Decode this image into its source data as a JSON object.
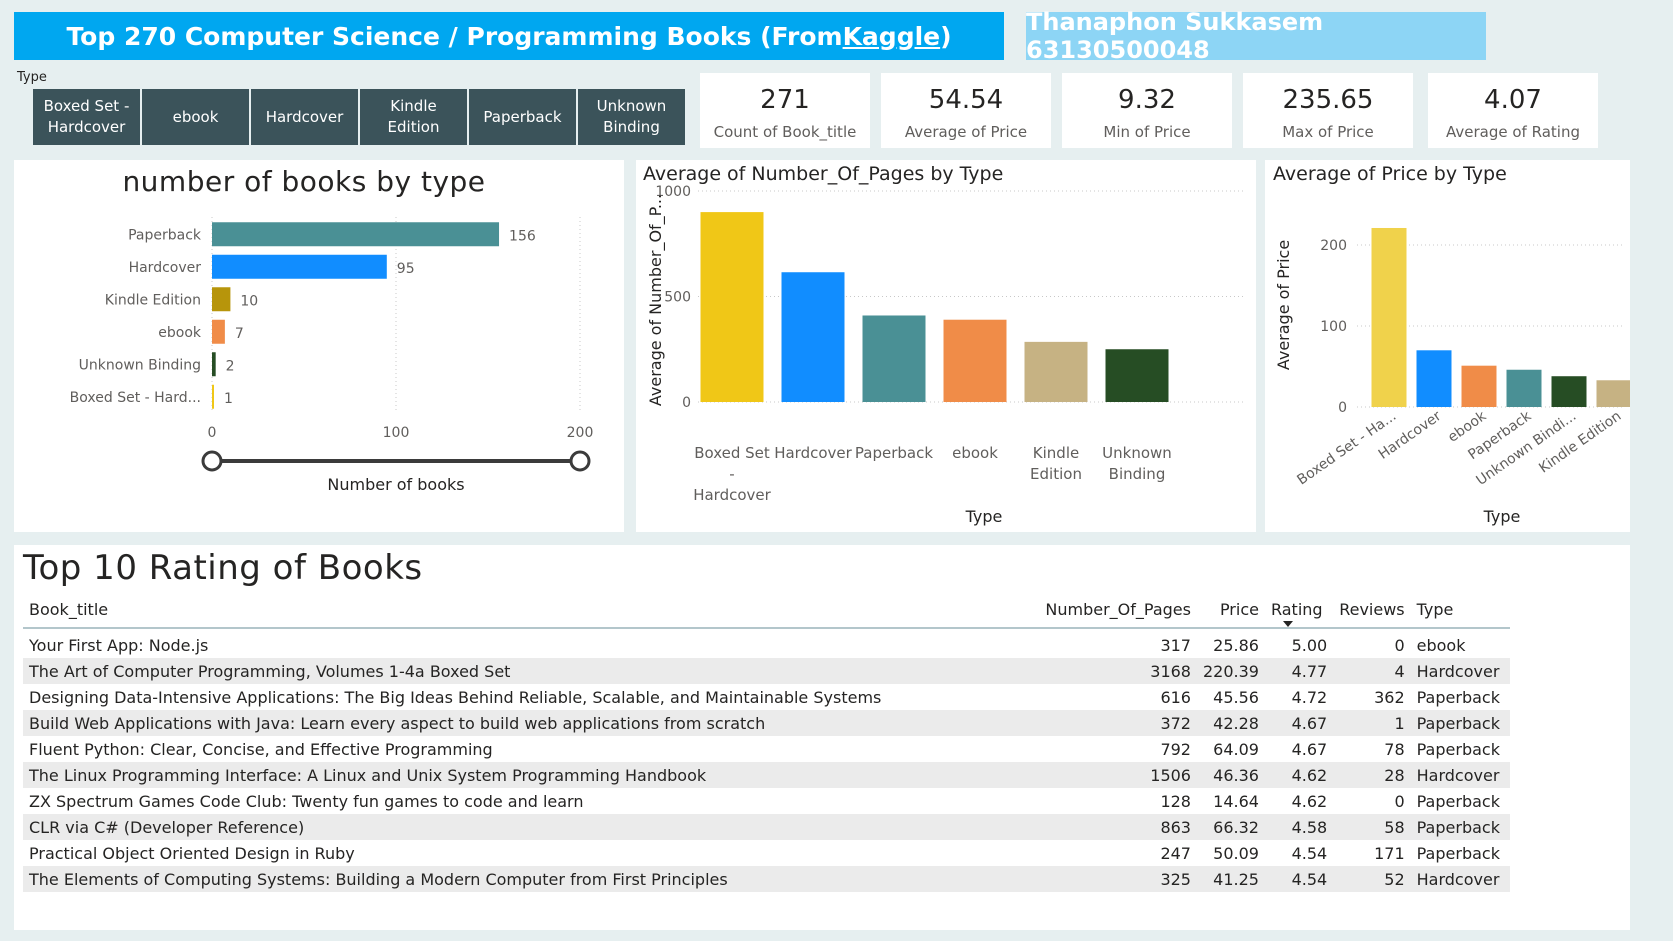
{
  "header": {
    "title_prefix": "Top 270 Computer Science / Programming Books (From ",
    "title_link": "Kaggle",
    "title_suffix": ")",
    "author": "Thanaphon Sukkasem 63130500048"
  },
  "slicer": {
    "label": "Type",
    "options": [
      "Boxed Set - Hardcover",
      "ebook",
      "Hardcover",
      "Kindle Edition",
      "Paperback",
      "Unknown Binding"
    ]
  },
  "cards": [
    {
      "value": "271",
      "label": "Count of Book_title"
    },
    {
      "value": "54.54",
      "label": "Average of Price"
    },
    {
      "value": "9.32",
      "label": "Min of Price"
    },
    {
      "value": "235.65",
      "label": "Max of Price"
    },
    {
      "value": "4.07",
      "label": "Average of Rating"
    }
  ],
  "colors": {
    "title_bg": "#00a7f0",
    "author_bg": "#8dd5f5",
    "slicer_bg": "#3b535a",
    "page_bg": "#e6eff0",
    "teal": "#4a9095",
    "blue": "#118dff",
    "olive": "#b7950b",
    "orange": "#f08c48",
    "darkgreen": "#264d24",
    "yellow": "#f0c717",
    "yellow_light": "#f0d24b",
    "tan": "#c6b283"
  },
  "chart_data": [
    {
      "type": "bar",
      "orientation": "horizontal",
      "title": "number of books by type",
      "categories": [
        "Paperback",
        "Hardcover",
        "Kindle Edition",
        "ebook",
        "Unknown Binding",
        "Boxed Set - Hard..."
      ],
      "values": [
        156,
        95,
        10,
        7,
        2,
        1
      ],
      "colors": [
        "#4a9095",
        "#118dff",
        "#b7950b",
        "#f08c48",
        "#264d24",
        "#f0c717"
      ],
      "xlabel": "Number of books",
      "xlim": [
        0,
        200
      ],
      "xticks": [
        "0",
        "100",
        "200"
      ],
      "grid": true,
      "range_slider": true
    },
    {
      "type": "bar",
      "title": "Average of Number_Of_Pages by Type",
      "categories": [
        "Boxed Set - Hardcover",
        "Hardcover",
        "Paperback",
        "ebook",
        "Kindle Edition",
        "Unknown Binding"
      ],
      "category_lines": [
        [
          "Boxed Set",
          "-",
          "Hardcover"
        ],
        [
          "Hardcover"
        ],
        [
          "Paperback"
        ],
        [
          "ebook"
        ],
        [
          "Kindle",
          "Edition"
        ],
        [
          "Unknown",
          "Binding"
        ]
      ],
      "values": [
        900,
        615,
        410,
        390,
        285,
        250
      ],
      "colors": [
        "#f0c717",
        "#118dff",
        "#4a9095",
        "#f08c48",
        "#c6b283",
        "#264d24"
      ],
      "xlabel": "Type",
      "ylabel": "Average of Number_Of_P...",
      "ylim": [
        0,
        1000
      ],
      "yticks": [
        "0",
        "500",
        "1000"
      ],
      "grid": true
    },
    {
      "type": "bar",
      "title": "Average of Price by Type",
      "categories": [
        "Boxed Set - Ha...",
        "Hardcover",
        "ebook",
        "Paperback",
        "Unknown Bindi...",
        "Kindle Edition"
      ],
      "values": [
        221,
        70,
        51,
        46,
        38,
        33
      ],
      "colors": [
        "#f0d24b",
        "#118dff",
        "#f08c48",
        "#4a9095",
        "#264d24",
        "#c6b283"
      ],
      "xlabel": "Type",
      "ylabel": "Average of Price",
      "ylim": [
        0,
        230
      ],
      "yticks": [
        "0",
        "100",
        "200"
      ],
      "grid": true
    },
    {
      "type": "table",
      "title": "Top 10 Rating of Books",
      "columns": [
        "Book_title",
        "Number_Of_Pages",
        "Price",
        "Rating",
        "Reviews",
        "Type"
      ],
      "sorted_by": "Rating",
      "rows": [
        [
          "Your First App: Node.js",
          "317",
          "25.86",
          "5.00",
          "0",
          "ebook"
        ],
        [
          "The Art of Computer Programming, Volumes 1-4a Boxed Set",
          "3168",
          "220.39",
          "4.77",
          "4",
          "Hardcover"
        ],
        [
          "Designing Data-Intensive Applications: The Big Ideas Behind Reliable, Scalable, and Maintainable Systems",
          "616",
          "45.56",
          "4.72",
          "362",
          "Paperback"
        ],
        [
          "Build Web Applications with Java: Learn every aspect to build web applications from scratch",
          "372",
          "42.28",
          "4.67",
          "1",
          "Paperback"
        ],
        [
          "Fluent Python: Clear, Concise, and Effective Programming",
          "792",
          "64.09",
          "4.67",
          "78",
          "Paperback"
        ],
        [
          "The Linux Programming Interface: A Linux and Unix System Programming Handbook",
          "1506",
          "46.36",
          "4.62",
          "28",
          "Hardcover"
        ],
        [
          "ZX Spectrum Games Code Club: Twenty fun games to code and learn",
          "128",
          "14.64",
          "4.62",
          "0",
          "Paperback"
        ],
        [
          "CLR via C# (Developer Reference)",
          "863",
          "66.32",
          "4.58",
          "58",
          "Paperback"
        ],
        [
          "Practical Object Oriented Design in Ruby",
          "247",
          "50.09",
          "4.54",
          "171",
          "Paperback"
        ],
        [
          "The Elements of Computing Systems: Building a Modern Computer from First Principles",
          "325",
          "41.25",
          "4.54",
          "52",
          "Hardcover"
        ]
      ]
    }
  ]
}
